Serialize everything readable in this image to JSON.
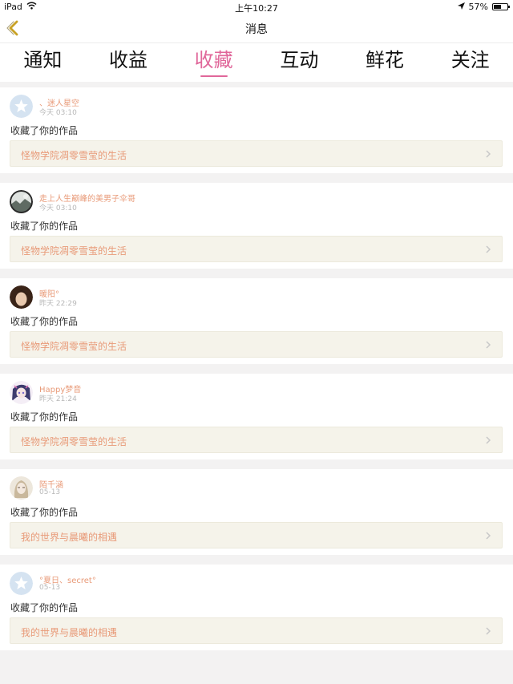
{
  "status_bar": {
    "device": "iPad",
    "time": "上午10:27",
    "battery": "57%",
    "battery_level": 0.57
  },
  "nav": {
    "title": "消息",
    "back_icon": "chevron-left-icon"
  },
  "tabs": [
    {
      "label": "通知",
      "active": false
    },
    {
      "label": "收益",
      "active": false
    },
    {
      "label": "收藏",
      "active": true
    },
    {
      "label": "互动",
      "active": false
    },
    {
      "label": "鲜花",
      "active": false
    },
    {
      "label": "关注",
      "active": false
    }
  ],
  "colors": {
    "accent": "#e0679a",
    "username": "#e89a78",
    "work_title": "#e89a78"
  },
  "notifications": [
    {
      "user": "、迷人星空",
      "time": "今天 03:10",
      "action": "收藏了你的作品",
      "work": "怪物学院凋零雪莹的生活",
      "avatar": "default-star-avatar"
    },
    {
      "user": "走上人生巅峰的美男子伞哥",
      "time": "今天 03:10",
      "action": "收藏了你的作品",
      "work": "怪物学院凋零雪莹的生活",
      "avatar": "photo-avatar"
    },
    {
      "user": "暖阳°",
      "time": "昨天 22:29",
      "action": "收藏了你的作品",
      "work": "怪物学院凋零雪莹的生活",
      "avatar": "photo-avatar"
    },
    {
      "user": "Happy梦音",
      "time": "昨天 21:24",
      "action": "收藏了你的作品",
      "work": "怪物学院凋零雪莹的生活",
      "avatar": "anime-avatar"
    },
    {
      "user": "陌千涵",
      "time": "05-13",
      "action": "收藏了你的作品",
      "work": "我的世界与晨曦的相遇",
      "avatar": "photo-avatar"
    },
    {
      "user": "°夏日、secret°",
      "time": "05-13",
      "action": "收藏了你的作品",
      "work": "我的世界与晨曦的相遇",
      "avatar": "default-star-avatar"
    }
  ]
}
